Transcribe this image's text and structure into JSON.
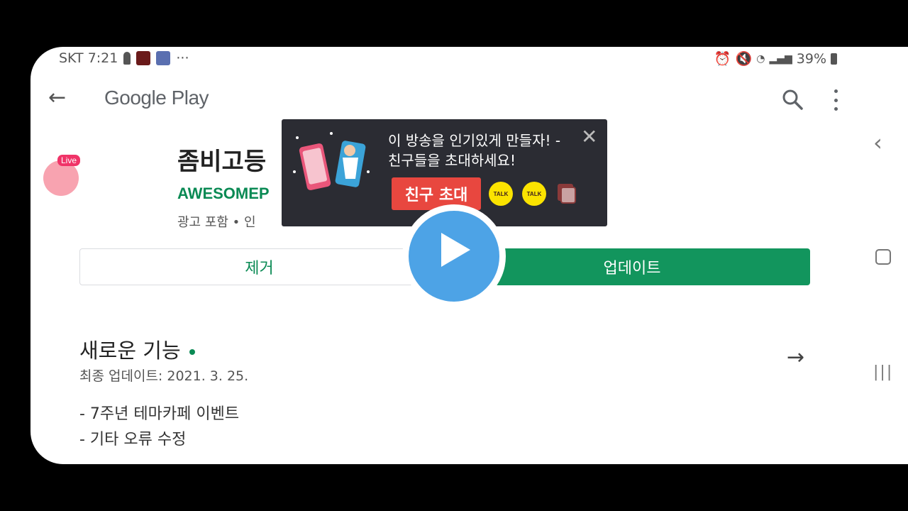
{
  "status_bar": {
    "carrier_time": "SKT 7:21",
    "more": "···",
    "battery": "39%"
  },
  "toolbar": {
    "title": "Google Play"
  },
  "app": {
    "title": "좀비고등",
    "developer": "AWESOMEP",
    "meta": "광고 포함 • 인",
    "live_badge": "Live"
  },
  "buttons": {
    "remove": "제거",
    "update": "업데이트"
  },
  "whats_new": {
    "heading": "새로운 기능",
    "updated": "최종 업데이트: 2021. 3. 25.",
    "notes": [
      "- 7주년 테마카페 이벤트",
      "- 기타 오류 수정"
    ]
  },
  "popup": {
    "line1": "이 방송을 인기있게 만들자! -",
    "line2": "친구들을 초대하세요!",
    "invite": "친구 초대",
    "talk1": "TALK",
    "talk2": "TALK"
  },
  "colors": {
    "accent_green": "#12955d",
    "popup_bg": "#2b2c33",
    "invite_red": "#e8473f",
    "play_blue": "#4da3e6",
    "kakao_yellow": "#fbe300"
  }
}
